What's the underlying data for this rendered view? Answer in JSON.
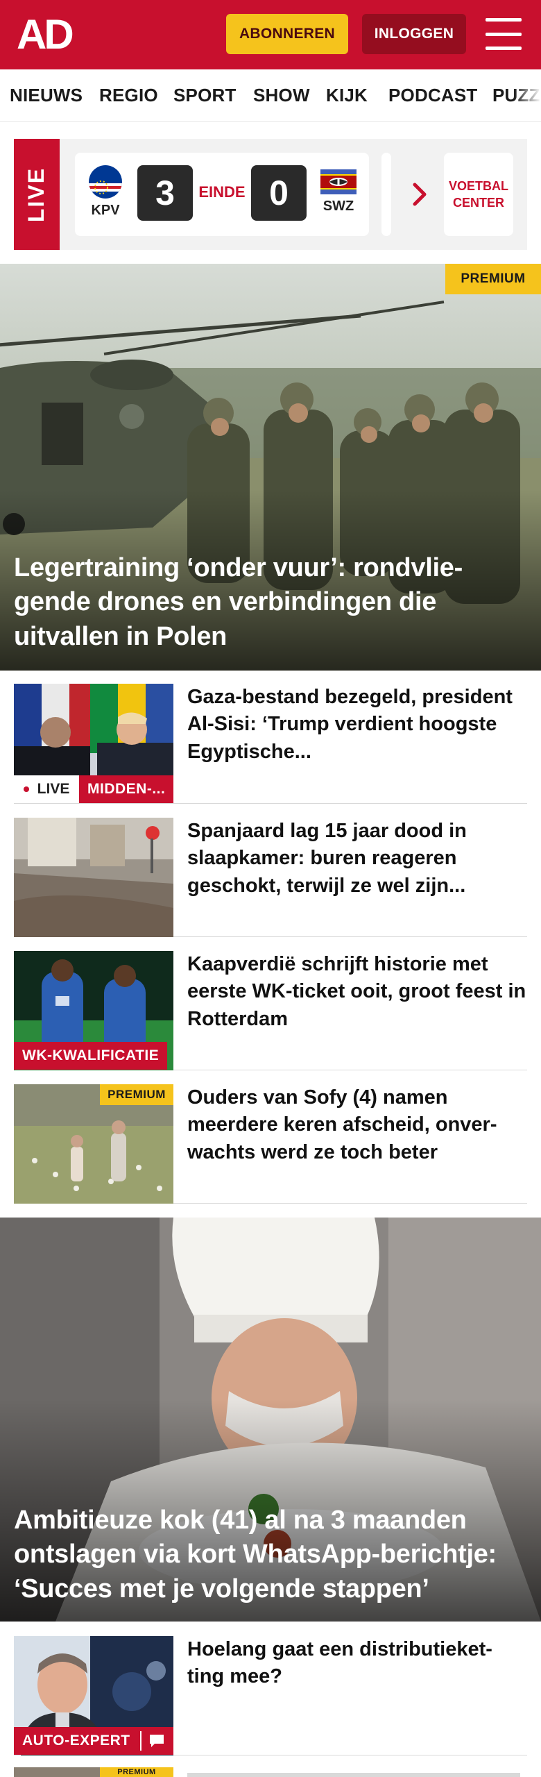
{
  "header": {
    "logo_text": "AD",
    "subscribe_label": "ABONNEREN",
    "login_label": "INLOGGEN",
    "menu_icon": "hamburger-menu-icon",
    "brand_color": "#c8102e",
    "accent_color": "#f5c31c"
  },
  "nav": {
    "items": [
      "NIEUWS",
      "REGIO",
      "SPORT",
      "SHOW",
      "KIJK",
      "PODCAST",
      "PUZZ"
    ]
  },
  "live": {
    "label": "LIVE",
    "match": {
      "home_code": "KPV",
      "home_score": "3",
      "status": "EINDE",
      "away_score": "0",
      "away_code": "SWZ"
    },
    "voetbal_center_line1": "VOETBAL",
    "voetbal_center_line2": "CENTER"
  },
  "hero1": {
    "badge": "PREMIUM",
    "headline": "Legertraining ‘onder vuur’: rondvlie-gende drones en verbindingen die uitvallen in Polen"
  },
  "articles": [
    {
      "headline": "Gaza-bestand bezegeld, president Al-Sisi: ‘Trump verdient hoogste Egyptische...",
      "live_label": "LIVE",
      "category": "MIDDEN-..."
    },
    {
      "headline": "Spanjaard lag 15 jaar dood in slaapkamer: buren reageren geschokt, terwijl ze wel zijn..."
    },
    {
      "headline": "Kaapverdië schrijft historie met eerste WK-ticket ooit, groot feest in Rotterdam",
      "category": "WK-KWALIFICATIE"
    },
    {
      "headline": "Ouders van Sofy (4) namen meerdere keren afscheid, onver-wachts werd ze toch beter",
      "badge": "PREMIUM"
    }
  ],
  "hero2": {
    "headline": "Ambitieuze kok (41) al na 3 maanden ontslagen via kort WhatsApp-berichtje: ‘Succes met je volgende stappen’"
  },
  "article_bottom": {
    "headline": "Hoelang gaat een distributieket-ting mee?",
    "category": "AUTO-EXPERT",
    "comment_icon": "comment-icon"
  },
  "article_cut": {
    "badge": "PREMIUM"
  }
}
